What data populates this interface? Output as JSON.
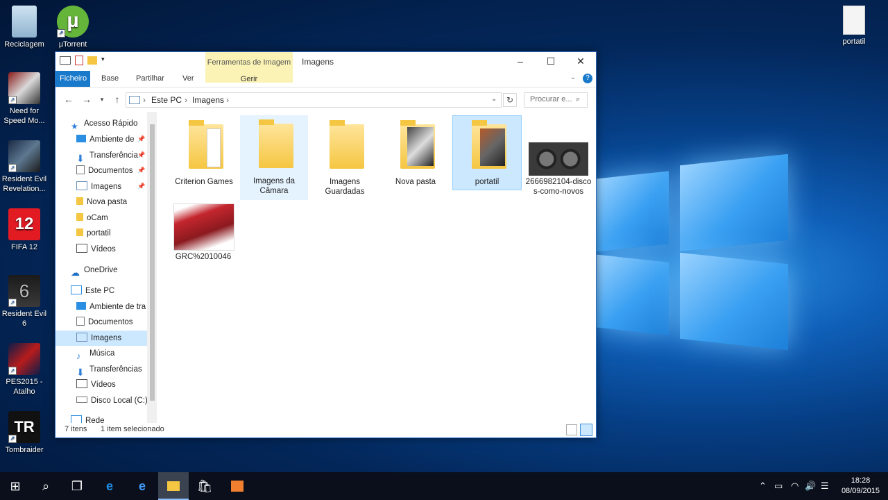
{
  "desktop": {
    "icons": [
      {
        "label": "Reciclagem"
      },
      {
        "label": "µTorrent"
      },
      {
        "label": "Need for Speed Mo..."
      },
      {
        "label": "Resident Evil Revelation..."
      },
      {
        "label": "FIFA 12"
      },
      {
        "label": "Resident Evil 6"
      },
      {
        "label": "PES2015 - Atalho"
      },
      {
        "label": "Tombraider"
      },
      {
        "label": "portatil"
      }
    ]
  },
  "window": {
    "title": "Imagens",
    "context_tab": {
      "group": "Ferramentas de Imagem",
      "label": "Gerir"
    },
    "ribbon_tabs": [
      "Ficheiro",
      "Base",
      "Partilhar",
      "Ver"
    ],
    "address": {
      "segments": [
        "Este PC",
        "Imagens"
      ]
    },
    "search": {
      "placeholder": "Procurar e..."
    },
    "nav": [
      {
        "label": "Acesso Rápido",
        "icon": "star-icon",
        "pinned": false
      },
      {
        "label": "Ambiente de",
        "icon": "desktop-icon",
        "pinned": true
      },
      {
        "label": "Transferência",
        "icon": "download-icon",
        "pinned": true
      },
      {
        "label": "Documentos",
        "icon": "document-icon",
        "pinned": true
      },
      {
        "label": "Imagens",
        "icon": "pictures-icon",
        "pinned": true
      },
      {
        "label": "Nova pasta",
        "icon": "folder-icon",
        "pinned": false
      },
      {
        "label": "oCam",
        "icon": "folder-icon",
        "pinned": false
      },
      {
        "label": "portatil",
        "icon": "folder-icon",
        "pinned": false
      },
      {
        "label": "Vídeos",
        "icon": "video-icon",
        "pinned": false
      },
      {
        "label": "OneDrive",
        "icon": "cloud-icon",
        "pinned": false
      },
      {
        "label": "Este PC",
        "icon": "computer-icon",
        "pinned": false
      },
      {
        "label": "Ambiente de tra",
        "icon": "desktop-icon",
        "pinned": false
      },
      {
        "label": "Documentos",
        "icon": "document-icon",
        "pinned": false
      },
      {
        "label": "Imagens",
        "icon": "pictures-icon",
        "pinned": false
      },
      {
        "label": "Música",
        "icon": "music-icon",
        "pinned": false
      },
      {
        "label": "Transferências",
        "icon": "download-icon",
        "pinned": false
      },
      {
        "label": "Vídeos",
        "icon": "video-icon",
        "pinned": false
      },
      {
        "label": "Disco Local (C:)",
        "icon": "drive-icon",
        "pinned": false
      },
      {
        "label": "Rede",
        "icon": "network-icon",
        "pinned": false
      }
    ],
    "items": [
      {
        "label": "Criterion Games",
        "kind": "folder"
      },
      {
        "label": "Imagens da Câmara",
        "kind": "folder"
      },
      {
        "label": "Imagens Guardadas",
        "kind": "folder"
      },
      {
        "label": "Nova pasta",
        "kind": "folder"
      },
      {
        "label": "portatil",
        "kind": "folder"
      },
      {
        "label": "2666982104-discos-como-novos",
        "kind": "image"
      },
      {
        "label": "GRC%2010046",
        "kind": "image"
      }
    ],
    "status": {
      "count": "7 itens",
      "selection": "1 item selecionado"
    }
  },
  "taskbar": {
    "time": "18:28",
    "date": "08/09/2015"
  }
}
